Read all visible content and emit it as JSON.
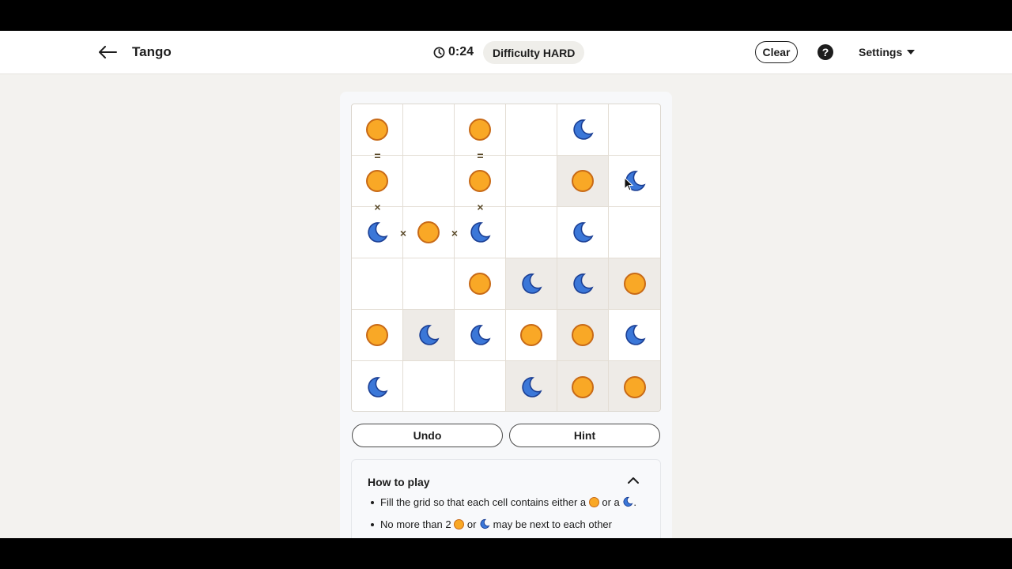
{
  "header": {
    "title": "Tango",
    "timer": "0:24",
    "difficulty_label": "Difficulty",
    "difficulty_value": "HARD",
    "clear_label": "Clear",
    "help_label": "?",
    "settings_label": "Settings"
  },
  "board": {
    "rows": 6,
    "cols": 6,
    "cells": [
      [
        "sun",
        "",
        "sun",
        "",
        "moon",
        ""
      ],
      [
        "sun",
        "",
        "sun",
        "",
        "sun",
        "moon"
      ],
      [
        "moon",
        "sun",
        "moon",
        "",
        "moon",
        ""
      ],
      [
        "",
        "",
        "sun",
        "moon",
        "moon",
        "sun"
      ],
      [
        "sun",
        "moon",
        "moon",
        "sun",
        "sun",
        "moon"
      ],
      [
        "moon",
        "",
        "",
        "moon",
        "sun",
        "sun"
      ]
    ],
    "locked": [
      [
        false,
        false,
        false,
        false,
        false,
        false
      ],
      [
        false,
        false,
        false,
        false,
        true,
        false
      ],
      [
        false,
        false,
        false,
        false,
        false,
        false
      ],
      [
        false,
        false,
        false,
        true,
        true,
        true
      ],
      [
        false,
        true,
        false,
        false,
        true,
        false
      ],
      [
        false,
        false,
        false,
        true,
        true,
        true
      ]
    ],
    "constraints": [
      {
        "type": "=",
        "between": [
          [
            0,
            0
          ],
          [
            1,
            0
          ]
        ]
      },
      {
        "type": "=",
        "between": [
          [
            0,
            2
          ],
          [
            1,
            2
          ]
        ]
      },
      {
        "type": "×",
        "between": [
          [
            1,
            0
          ],
          [
            2,
            0
          ]
        ]
      },
      {
        "type": "×",
        "between": [
          [
            1,
            2
          ],
          [
            2,
            2
          ]
        ]
      },
      {
        "type": "×",
        "between": [
          [
            2,
            0
          ],
          [
            2,
            1
          ]
        ]
      },
      {
        "type": "×",
        "between": [
          [
            2,
            1
          ],
          [
            2,
            2
          ]
        ]
      }
    ]
  },
  "actions": {
    "undo_label": "Undo",
    "hint_label": "Hint"
  },
  "how_to_play": {
    "title": "How to play",
    "rule1_a": "Fill the grid so that each cell contains either a",
    "rule1_b": "or a",
    "rule1_c": ".",
    "rule2_a": "No more than 2",
    "rule2_b": "or",
    "rule2_c": "may be next to each other"
  },
  "icons": {
    "back": "arrow-left-icon",
    "timer": "clock-icon",
    "help": "question-circle-icon",
    "settings_caret": "caret-down-icon",
    "collapse": "chevron-up-icon",
    "sun": "sun-icon",
    "moon": "moon-icon"
  },
  "colors": {
    "sun_fill": "#f9a826",
    "sun_stroke": "#c86a17",
    "moon_fill": "#3b77d8",
    "moon_stroke": "#1b3f94",
    "locked_cell": "#eeebe7"
  }
}
